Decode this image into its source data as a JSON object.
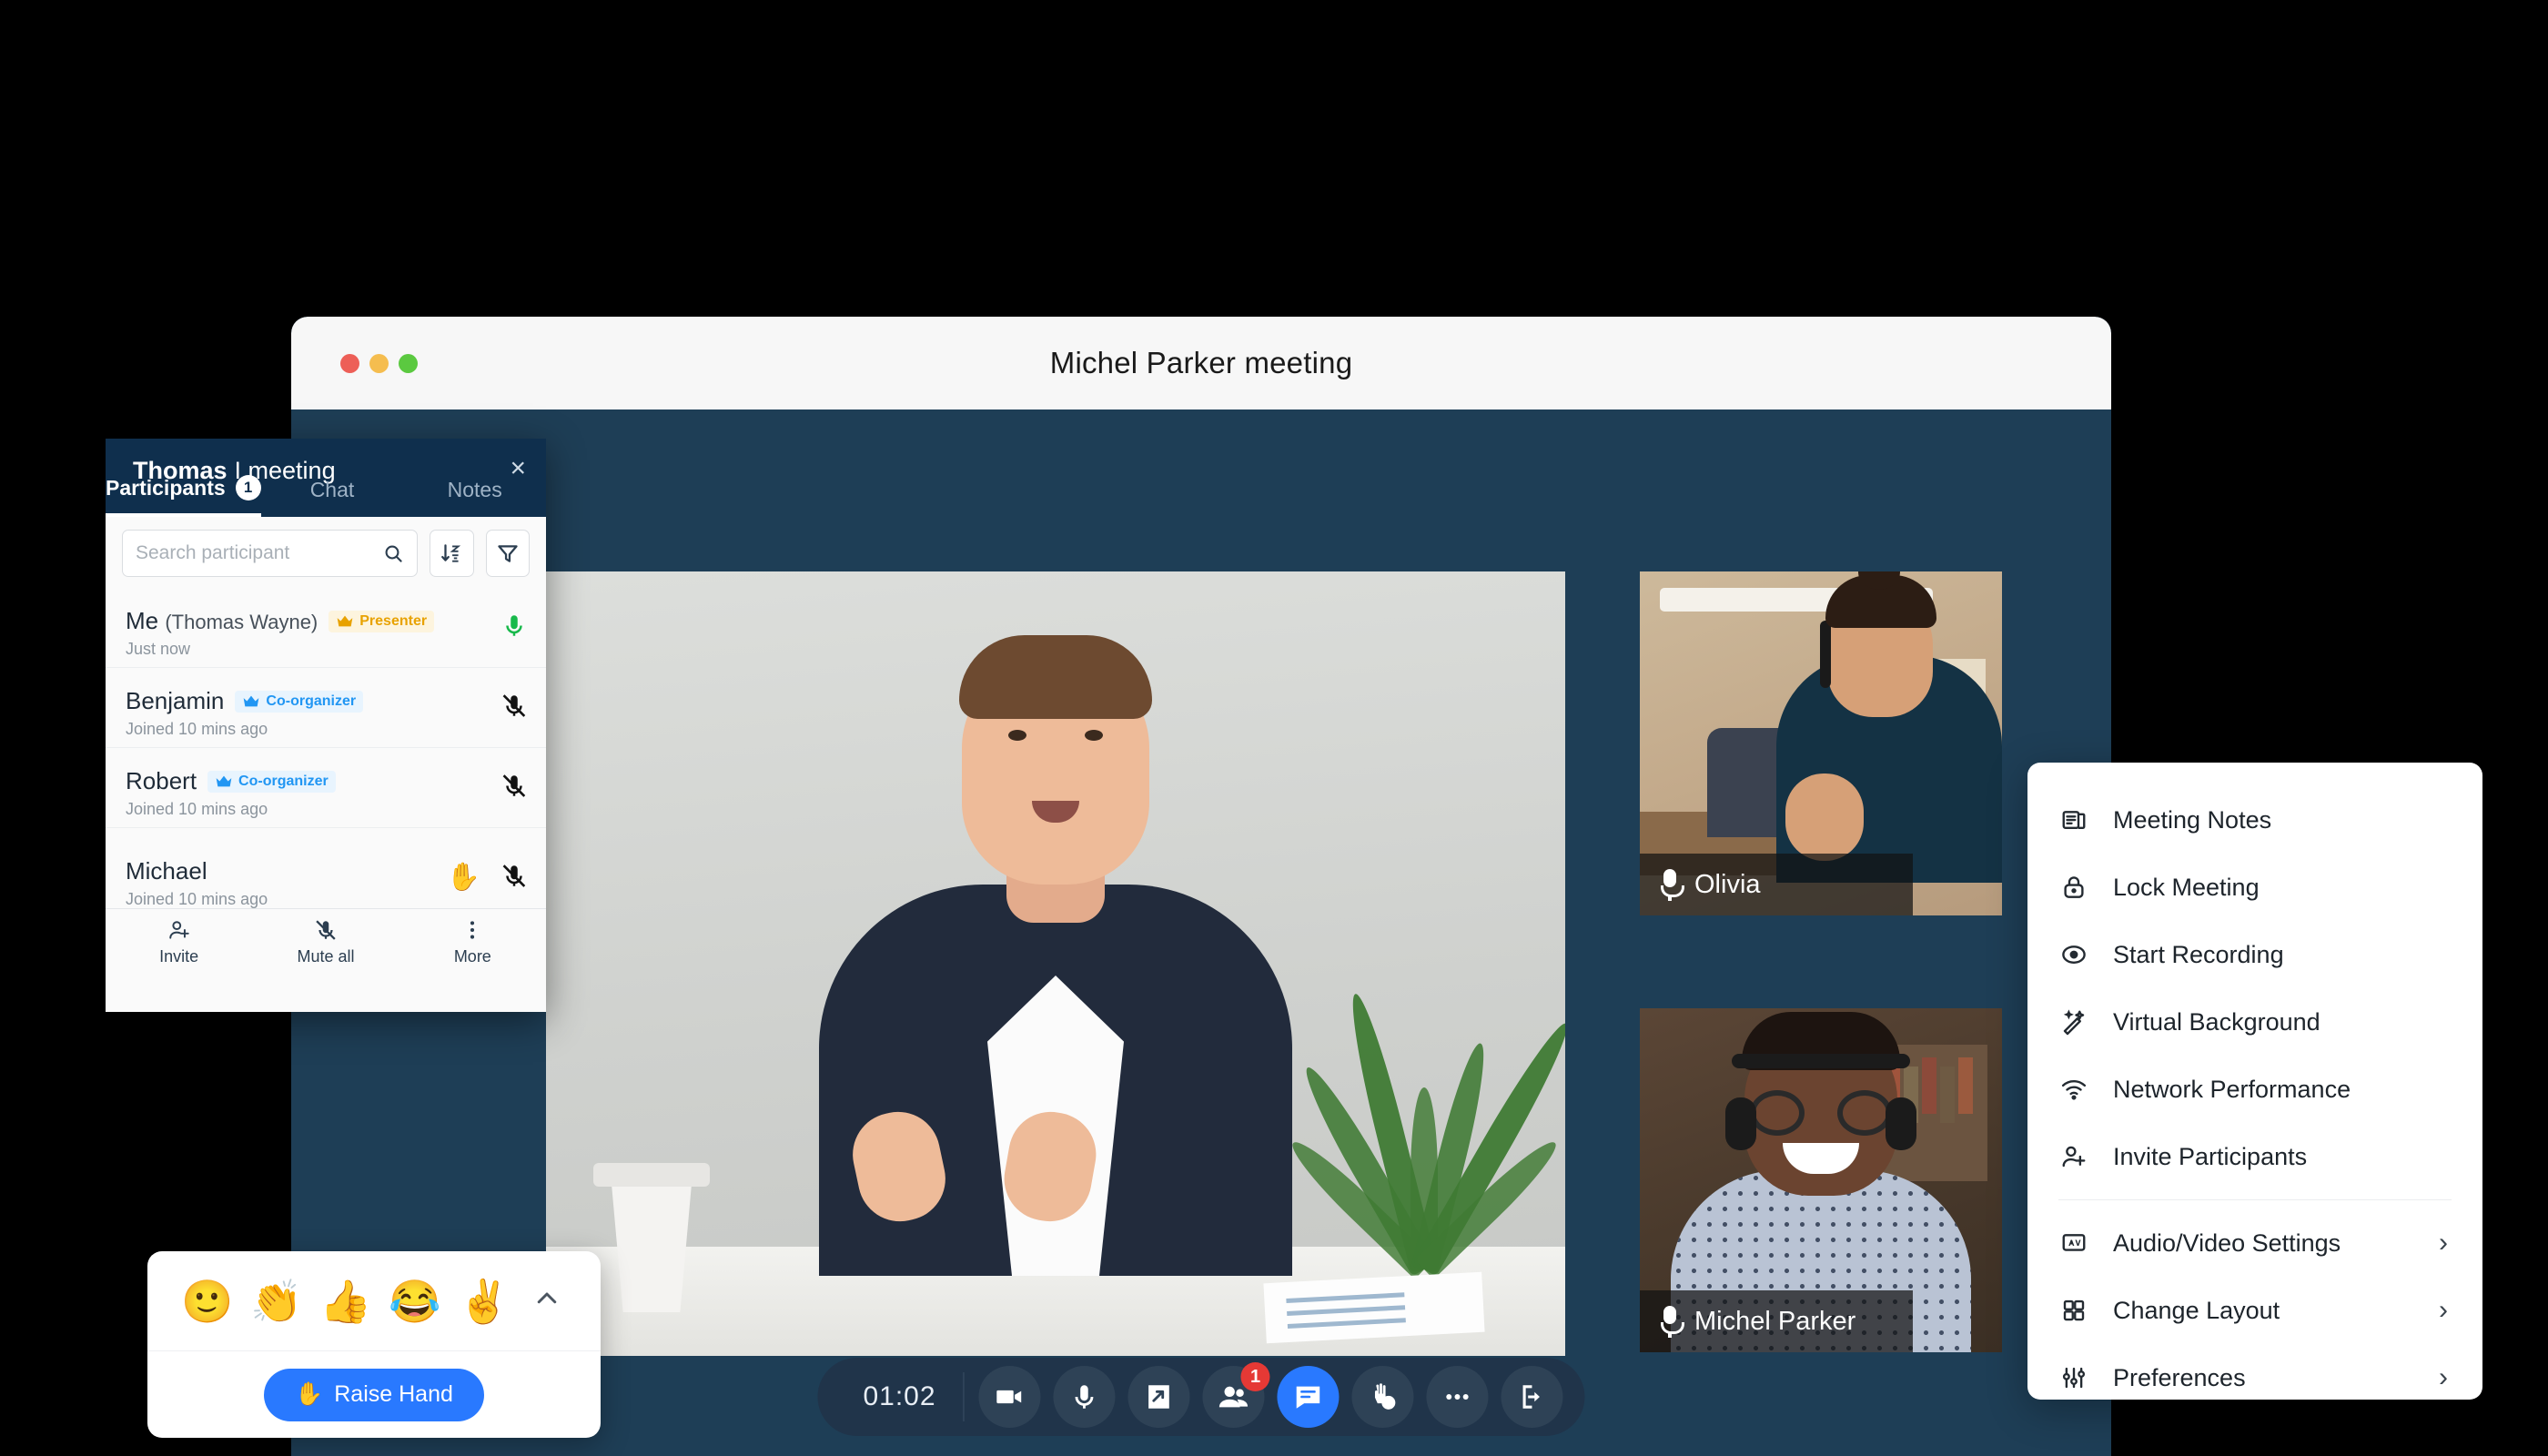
{
  "window": {
    "title": "Michel Parker meeting",
    "traffic_lights": [
      "close",
      "minimize",
      "maximize"
    ]
  },
  "participants_panel": {
    "header_name": "Thomas",
    "header_suffix": "I meeting",
    "close_icon": "close-icon",
    "tabs": [
      {
        "label": "Participants",
        "badge": "1",
        "selected": true
      },
      {
        "label": "Chat",
        "badge": "",
        "selected": false
      },
      {
        "label": "Notes",
        "badge": "",
        "selected": false
      }
    ],
    "search": {
      "placeholder": "Search participant",
      "value": "",
      "search_icon": "search-icon",
      "sort_icon": "sort-az-icon",
      "filter_icon": "filter-funnel-icon"
    },
    "rows": [
      {
        "name": "Me",
        "name_extra": "(Thomas Wayne)",
        "badge": "Presenter",
        "badge_type": "presenter",
        "status": "Just now",
        "mic": "on",
        "hand_raised": false
      },
      {
        "name": "Benjamin",
        "name_extra": "",
        "badge": "Co-organizer",
        "badge_type": "coorg",
        "status": "Joined 10 mins ago",
        "mic": "off",
        "hand_raised": false
      },
      {
        "name": "Robert",
        "name_extra": "",
        "badge": "Co-organizer",
        "badge_type": "coorg",
        "status": "Joined 10 mins ago",
        "mic": "off",
        "hand_raised": false
      },
      {
        "name": "Michael",
        "name_extra": "",
        "badge": "",
        "badge_type": "",
        "status": "Joined 10 mins ago",
        "mic": "off",
        "hand_raised": true
      }
    ],
    "footer": [
      {
        "label": "Invite",
        "icon": "person-add-icon"
      },
      {
        "label": "Mute all",
        "icon": "mic-off-icon"
      },
      {
        "label": "More",
        "icon": "more-vertical-icon"
      }
    ]
  },
  "video_tiles": [
    {
      "name": "Olivia",
      "mic_icon": "mic-icon"
    },
    {
      "name": "Michel Parker",
      "mic_icon": "mic-icon"
    }
  ],
  "toolbar": {
    "timer": "01:02",
    "buttons": [
      {
        "name": "camera",
        "icon": "video-camera-icon",
        "active": false,
        "badge": ""
      },
      {
        "name": "microphone",
        "icon": "mic-icon",
        "active": false,
        "badge": ""
      },
      {
        "name": "share-screen",
        "icon": "share-screen-icon",
        "active": false,
        "badge": ""
      },
      {
        "name": "participants",
        "icon": "people-icon",
        "active": false,
        "badge": "1"
      },
      {
        "name": "chat",
        "icon": "chat-bubble-icon",
        "active": true,
        "badge": ""
      },
      {
        "name": "reactions",
        "icon": "raise-hand-emoji-icon",
        "active": false,
        "badge": ""
      },
      {
        "name": "more",
        "icon": "more-horizontal-icon",
        "active": false,
        "badge": ""
      },
      {
        "name": "leave",
        "icon": "leave-meeting-icon",
        "active": false,
        "badge": ""
      }
    ]
  },
  "reactions_popover": {
    "emojis": [
      {
        "name": "smiling-face-emoji",
        "glyph": "🙂"
      },
      {
        "name": "clapping-hands-emoji",
        "glyph": "👏"
      },
      {
        "name": "thumbs-up-emoji",
        "glyph": "👍"
      },
      {
        "name": "laughing-face-emoji",
        "glyph": "😂"
      },
      {
        "name": "victory-hand-emoji",
        "glyph": "✌"
      }
    ],
    "collapse_icon": "chevron-up-icon",
    "raise_hand": {
      "label": "Raise Hand",
      "glyph": "✋"
    }
  },
  "context_menu": {
    "items": [
      {
        "label": "Meeting Notes",
        "icon": "notes-icon",
        "submenu": false
      },
      {
        "label": "Lock Meeting",
        "icon": "lock-icon",
        "submenu": false
      },
      {
        "label": "Start Recording",
        "icon": "record-icon",
        "submenu": false
      },
      {
        "label": "Virtual Background",
        "icon": "magic-wand-icon",
        "submenu": false
      },
      {
        "label": "Network Performance",
        "icon": "wifi-icon",
        "submenu": false
      },
      {
        "label": "Invite Participants",
        "icon": "person-add-icon",
        "submenu": false
      },
      {
        "label": "Audio/Video Settings",
        "icon": "av-settings-icon",
        "submenu": true
      },
      {
        "label": "Change Layout",
        "icon": "grid-layout-icon",
        "submenu": true
      },
      {
        "label": "Preferences",
        "icon": "sliders-icon",
        "submenu": true
      }
    ],
    "separator_after_index": 5,
    "submenu_chevron": "chevron-right-icon"
  },
  "colors": {
    "app_background": "#1e3e56",
    "panel_header": "#0f2f4d",
    "accent_blue": "#2979ff",
    "presenter_gold": "#e8a200",
    "coorganizer_blue": "#2196f3",
    "mic_on_green": "#18b94b",
    "badge_red": "#e53935",
    "toolbar_bg": "#20344a",
    "page_background": "#000000"
  }
}
